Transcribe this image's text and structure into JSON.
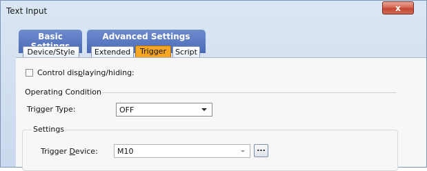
{
  "window": {
    "title": "Text Input",
    "close_label": "x"
  },
  "tab_groups": {
    "basic": "Basic Settings",
    "advanced": "Advanced Settings"
  },
  "tabs": {
    "device_style": "Device/Style",
    "extended": "Extended",
    "trigger": "Trigger",
    "script": "Script",
    "active": "Trigger"
  },
  "content": {
    "control_checkbox": {
      "label_pre": "Control dis",
      "label_underlined": "p",
      "label_post": "laying/hiding:",
      "checked": false
    },
    "operating_condition": "Operating Condition",
    "trigger_type": {
      "label_pre": "Tri",
      "label_underlined": "g",
      "label_post": "ger Type:",
      "value": "OFF"
    },
    "settings": {
      "title": "Settings",
      "trigger_device": {
        "label_pre": "Trigger ",
        "label_underlined": "D",
        "label_post": "evice:",
        "value": "M10"
      },
      "browse_label": "..."
    }
  },
  "colors": {
    "tab_group": "#4a69b7",
    "active_tab": "#f6a623",
    "close_button": "#c54735"
  }
}
